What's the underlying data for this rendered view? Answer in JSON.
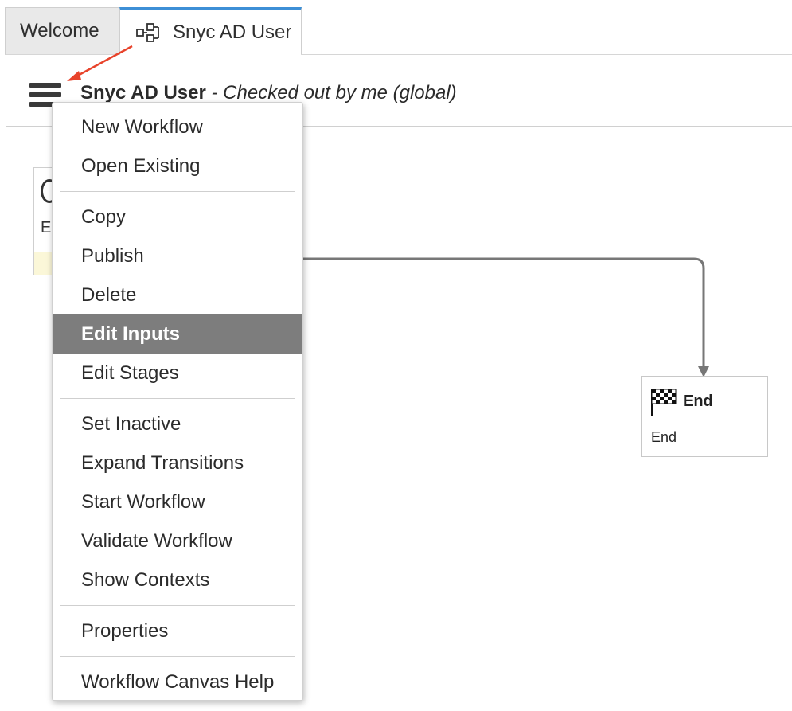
{
  "tabs": [
    {
      "label": "Welcome",
      "active": false
    },
    {
      "label": "Snyc AD User",
      "active": true,
      "icon": "workflow-icon"
    }
  ],
  "header": {
    "workflow_name": "Snyc AD User",
    "status": " - Checked out by me  (global)",
    "menu_icon": "hamburger-menu-icon"
  },
  "canvas": {
    "start_node": {
      "label": "E"
    },
    "end_node": {
      "title": "End",
      "subtitle": "End",
      "icon": "checkered-flag-icon"
    }
  },
  "menu": {
    "groups": [
      [
        "New Workflow",
        "Open Existing"
      ],
      [
        "Copy",
        "Publish",
        "Delete",
        "Edit Inputs",
        "Edit Stages"
      ],
      [
        "Set Inactive",
        "Expand Transitions",
        "Start Workflow",
        "Validate Workflow",
        "Show Contexts"
      ],
      [
        "Properties"
      ],
      [
        "Workflow Canvas Help"
      ]
    ],
    "highlighted": "Edit Inputs"
  },
  "colors": {
    "accent_tab": "#3d8fd6",
    "highlight": "#7d7d7d",
    "annotation_arrow": "#e8432b"
  }
}
